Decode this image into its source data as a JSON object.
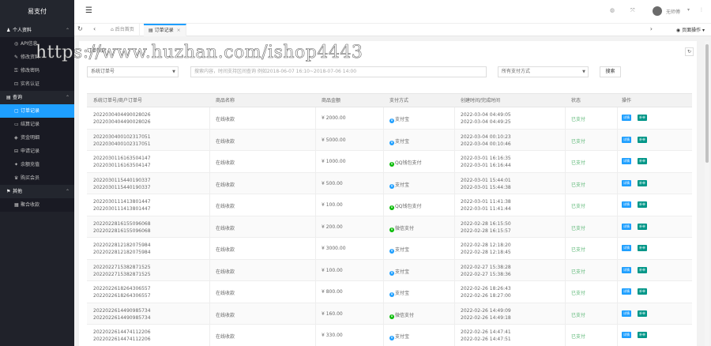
{
  "app": {
    "title": "易支付"
  },
  "sidebar": {
    "groups": [
      {
        "label": "个人资料",
        "icon": "user-icon",
        "items": [
          {
            "label": "API信息",
            "icon": "api-icon"
          },
          {
            "label": "修改资料",
            "icon": "edit-icon"
          },
          {
            "label": "修改密码",
            "icon": "lock-icon"
          },
          {
            "label": "实名认证",
            "icon": "id-icon"
          }
        ]
      },
      {
        "label": "查询",
        "icon": "search-icon",
        "items": [
          {
            "label": "订单记录",
            "icon": "order-icon",
            "active": true
          },
          {
            "label": "结算记录",
            "icon": "settle-icon"
          },
          {
            "label": "资金明细",
            "icon": "money-icon"
          },
          {
            "label": "申请记录",
            "icon": "apply-icon"
          },
          {
            "label": "余额充值",
            "icon": "recharge-icon"
          },
          {
            "label": "购买会员",
            "icon": "vip-icon"
          }
        ]
      },
      {
        "label": "其他",
        "icon": "other-icon",
        "items": [
          {
            "label": "聚合收款",
            "icon": "qr-icon"
          }
        ]
      }
    ]
  },
  "header": {
    "username": "无师傅",
    "theme_icon": "theme-icon",
    "fullscreen_icon": "fullscreen-icon"
  },
  "tabs": {
    "items": [
      {
        "label": "后台首页",
        "active": false
      },
      {
        "label": "订单记录",
        "active": true
      }
    ],
    "page_ops": "页面操作"
  },
  "filters": {
    "title": "订单筛选",
    "field_select": "系统订单号",
    "search_placeholder": "搜索内容，时间支持区间查询 例如2018-06-07 16:10~2018-07-06 14:00",
    "pay_type_select": "所有支付方式",
    "search_button": "搜索"
  },
  "table": {
    "headers": [
      "系统订单号/商户订单号",
      "商品名称",
      "商品金额",
      "支付方式",
      "创建时间/完成时间",
      "状态",
      "操作"
    ],
    "action_labels": {
      "notify": "补单",
      "detail": "详情"
    },
    "rows": [
      {
        "order_no": "2022030404490028026",
        "merchant_no": "2022030404490028026",
        "product": "在线收款",
        "amount": "¥ 2000.00",
        "pay": "支付宝",
        "pay_color": "#1e9fff",
        "created": "2022-03-04 04:49:05",
        "done": "2022-03-04 04:49:25",
        "status": "已支付"
      },
      {
        "order_no": "2022030400102317051",
        "merchant_no": "2022030400102317051",
        "product": "在线收款",
        "amount": "¥ 5000.00",
        "pay": "支付宝",
        "pay_color": "#1e9fff",
        "created": "2022-03-04 00:10:23",
        "done": "2022-03-04 00:10:46",
        "status": "已支付"
      },
      {
        "order_no": "2022030116163504147",
        "merchant_no": "2022030116163504147",
        "product": "在线收款",
        "amount": "¥ 1000.00",
        "pay": "QQ钱包支付",
        "pay_color": "#09bb07",
        "created": "2022-03-01 16:16:35",
        "done": "2022-03-01 16:16:44",
        "status": "已支付"
      },
      {
        "order_no": "2022030115440190337",
        "merchant_no": "2022030115440190337",
        "product": "在线收款",
        "amount": "¥ 500.00",
        "pay": "支付宝",
        "pay_color": "#1e9fff",
        "created": "2022-03-01 15:44:01",
        "done": "2022-03-01 15:44:38",
        "status": "已支付"
      },
      {
        "order_no": "2022030111413801447",
        "merchant_no": "2022030111413801447",
        "product": "在线收款",
        "amount": "¥ 100.00",
        "pay": "QQ钱包支付",
        "pay_color": "#09bb07",
        "created": "2022-03-01 11:41:38",
        "done": "2022-03-01 11:41:44",
        "status": "已支付"
      },
      {
        "order_no": "2022022816155096068",
        "merchant_no": "2022022816155096068",
        "product": "在线收款",
        "amount": "¥ 200.00",
        "pay": "微信支付",
        "pay_color": "#09bb07",
        "created": "2022-02-28 16:15:50",
        "done": "2022-02-28 16:15:57",
        "status": "已支付"
      },
      {
        "order_no": "2022022812182075984",
        "merchant_no": "2022022812182075984",
        "product": "在线收款",
        "amount": "¥ 3000.00",
        "pay": "支付宝",
        "pay_color": "#1e9fff",
        "created": "2022-02-28 12:18:20",
        "done": "2022-02-28 12:18:45",
        "status": "已支付"
      },
      {
        "order_no": "2022022715382871525",
        "merchant_no": "2022022715382871525",
        "product": "在线收款",
        "amount": "¥ 100.00",
        "pay": "支付宝",
        "pay_color": "#1e9fff",
        "created": "2022-02-27 15:38:28",
        "done": "2022-02-27 15:38:36",
        "status": "已支付"
      },
      {
        "order_no": "2022022618264306557",
        "merchant_no": "2022022618264306557",
        "product": "在线收款",
        "amount": "¥ 800.00",
        "pay": "支付宝",
        "pay_color": "#1e9fff",
        "created": "2022-02-26 18:26:43",
        "done": "2022-02-26 18:27:00",
        "status": "已支付"
      },
      {
        "order_no": "2022022614490985734",
        "merchant_no": "2022022614490985734",
        "product": "在线收款",
        "amount": "¥ 160.00",
        "pay": "微信支付",
        "pay_color": "#09bb07",
        "created": "2022-02-26 14:49:09",
        "done": "2022-02-26 14:49:18",
        "status": "已支付"
      },
      {
        "order_no": "2022022614474112206",
        "merchant_no": "2022022614474112206",
        "product": "在线收款",
        "amount": "¥ 330.00",
        "pay": "支付宝",
        "pay_color": "#1e9fff",
        "created": "2022-02-26 14:47:41",
        "done": "2022-02-26 14:47:51",
        "status": "已支付"
      }
    ]
  },
  "watermark": "https://www.huzhan.com/ishop4443",
  "colors": {
    "accent": "#1e9fff",
    "success": "#5fb878",
    "green_button": "#009688",
    "sidebar_bg": "#20222a"
  }
}
